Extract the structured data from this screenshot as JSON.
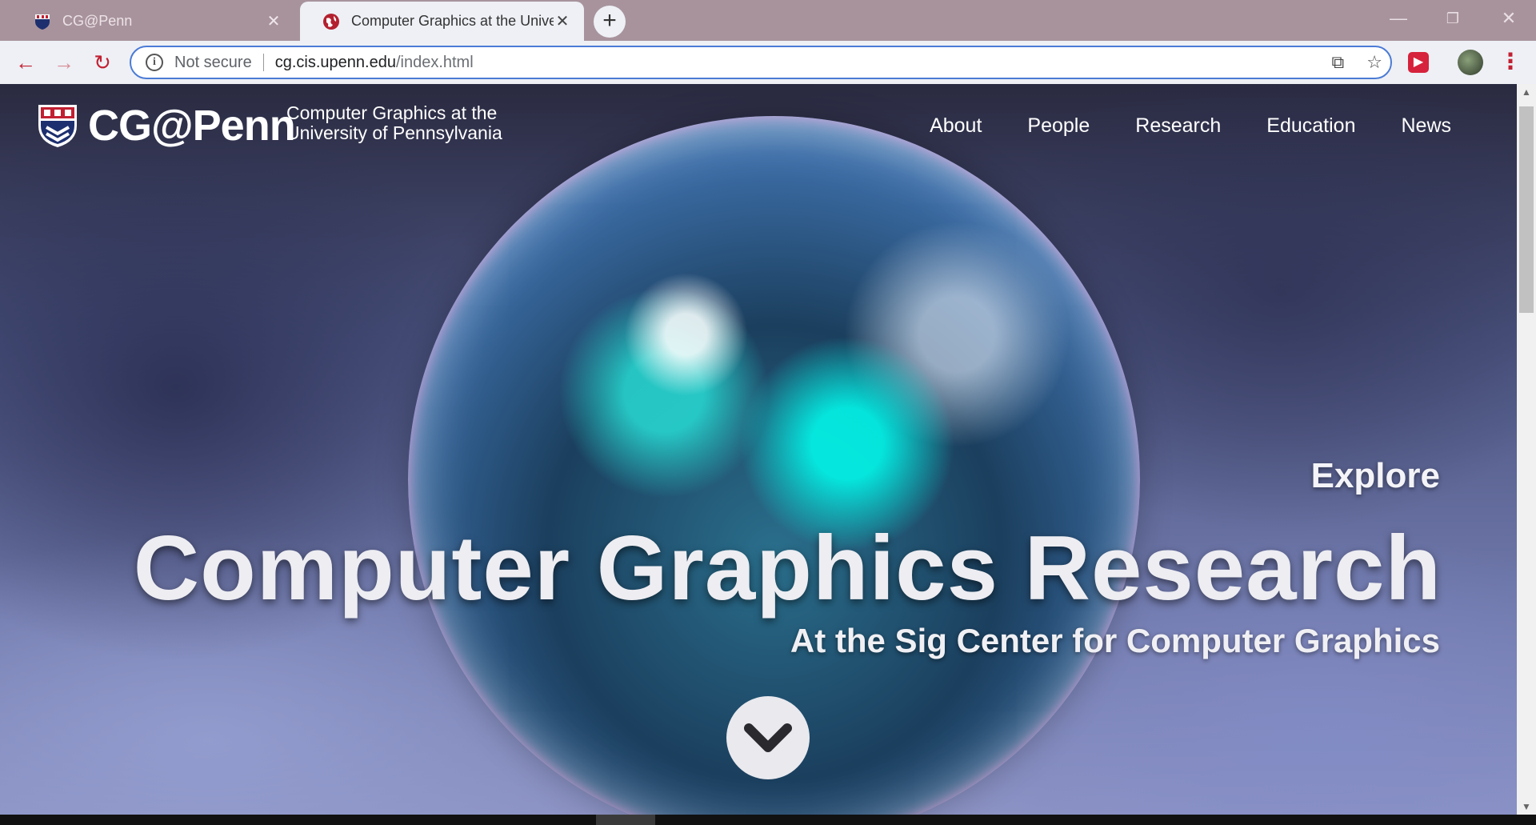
{
  "tabs": [
    {
      "title": "CG@Penn",
      "close": "✕",
      "active": false
    },
    {
      "title": "Computer Graphics at the University of Pennsylvania",
      "close": "✕",
      "active": true
    }
  ],
  "new_tab": "+",
  "window_controls": {
    "minimize": "—",
    "restore": "❐",
    "close": "✕"
  },
  "toolbar": {
    "back": "←",
    "forward": "→",
    "reload": "↻",
    "security_label": "Not secure",
    "url_host": "cg.cis.upenn.edu",
    "url_path": "/index.html",
    "cast_icon": "⧉",
    "star_icon": "☆",
    "menu_icon": "⋮"
  },
  "site": {
    "logo_text": "CG@Penn",
    "subtitle_line1": "Computer Graphics at the",
    "subtitle_line2": "University of Pennsylvania",
    "nav": [
      "About",
      "People",
      "Research",
      "Education",
      "News"
    ]
  },
  "hero": {
    "explore": "Explore",
    "title": "Computer Graphics Research",
    "subtitle": "At the Sig Center for Computer Graphics"
  },
  "colors": {
    "accent_red": "#c22032",
    "tab_strip": "#a8939c",
    "toolbar_bg": "#eef0f5",
    "omnibox_border": "#4b7bd6"
  }
}
